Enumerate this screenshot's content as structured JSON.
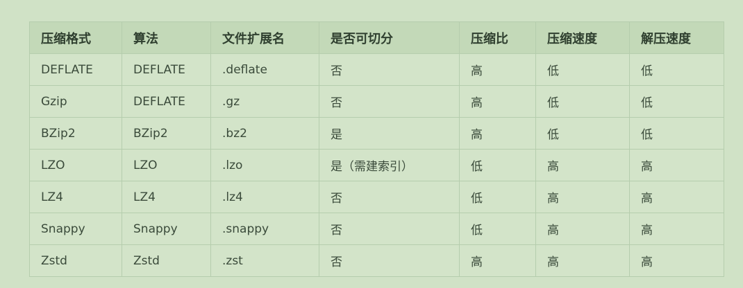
{
  "table": {
    "headers": [
      "压缩格式",
      "算法",
      "文件扩展名",
      "是否可切分",
      "压缩比",
      "压缩速度",
      "解压速度"
    ],
    "rows": [
      [
        "DEFLATE",
        "DEFLATE",
        ".deflate",
        "否",
        "高",
        "低",
        "低"
      ],
      [
        "Gzip",
        "DEFLATE",
        ".gz",
        "否",
        "高",
        "低",
        "低"
      ],
      [
        "BZip2",
        "BZip2",
        ".bz2",
        "是",
        "高",
        "低",
        "低"
      ],
      [
        "LZO",
        "LZO",
        ".lzo",
        "是（需建索引）",
        "低",
        "高",
        "高"
      ],
      [
        "LZ4",
        "LZ4",
        ".lz4",
        "否",
        "低",
        "高",
        "高"
      ],
      [
        "Snappy",
        "Snappy",
        ".snappy",
        "否",
        "低",
        "高",
        "高"
      ],
      [
        "Zstd",
        "Zstd",
        ".zst",
        "否",
        "高",
        "高",
        "高"
      ]
    ]
  }
}
